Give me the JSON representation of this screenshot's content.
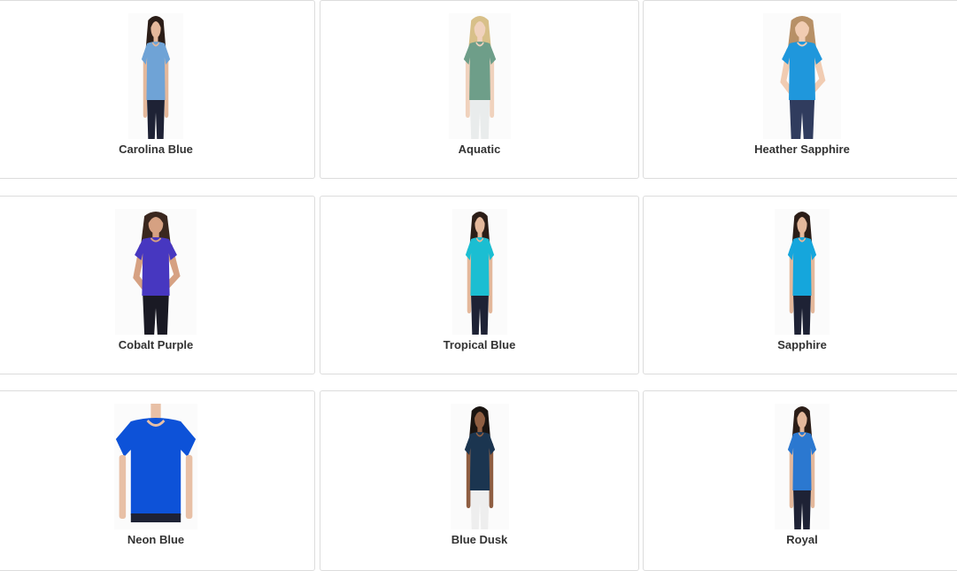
{
  "swatches": [
    {
      "name": "Carolina Blue",
      "shirt": "#6fa3d6",
      "hair": "#2b1d17",
      "skin": "#e4b89b",
      "pants": "#1e2235",
      "pose": "std"
    },
    {
      "name": "Aquatic",
      "shirt": "#6e9e89",
      "hair": "#d8c089",
      "skin": "#f0d2bd",
      "pants": "#e9ecec",
      "pose": "std"
    },
    {
      "name": "Heather Sapphire",
      "shirt": "#1f97dc",
      "hair": "#b79066",
      "skin": "#f1ccb2",
      "pants": "#303c5e",
      "pose": "hip"
    },
    {
      "name": "Cobalt Purple",
      "shirt": "#4737c0",
      "hair": "#3a271e",
      "skin": "#d6a182",
      "pants": "#1a1a24",
      "pose": "hip"
    },
    {
      "name": "Tropical Blue",
      "shirt": "#1bbed2",
      "hair": "#2b1d17",
      "skin": "#e4b89b",
      "pants": "#1e2235",
      "pose": "std"
    },
    {
      "name": "Sapphire",
      "shirt": "#15a6dc",
      "hair": "#2b1d17",
      "skin": "#e4b89b",
      "pants": "#1e2235",
      "pose": "std"
    },
    {
      "name": "Neon Blue",
      "shirt": "#0d52d8",
      "hair": "#2b1d17",
      "skin": "#e8c0a6",
      "pants": "#1e2235",
      "pose": "crop"
    },
    {
      "name": "Blue Dusk",
      "shirt": "#1b3550",
      "hair": "#1a1411",
      "skin": "#8f5e42",
      "pants": "#eeeeee",
      "pose": "std"
    },
    {
      "name": "Royal",
      "shirt": "#2b78d0",
      "hair": "#2b1d17",
      "skin": "#e4b89b",
      "pants": "#1e2235",
      "pose": "std"
    }
  ]
}
